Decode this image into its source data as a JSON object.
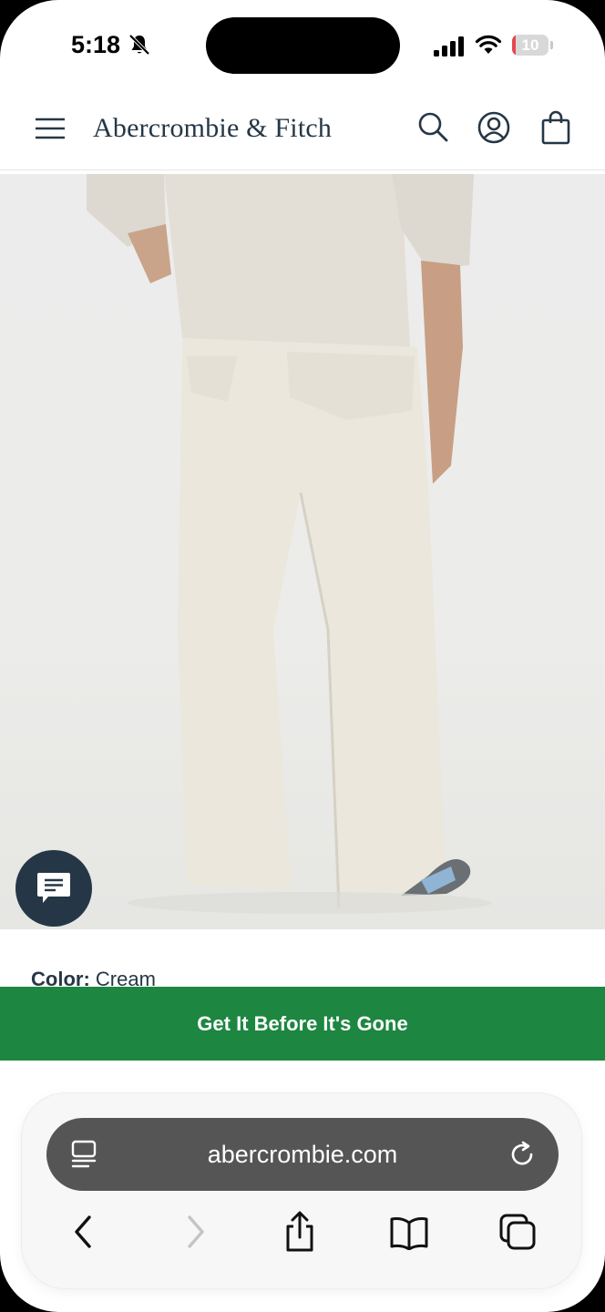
{
  "status_bar": {
    "time": "5:18",
    "battery_level": 10,
    "battery_label": "10"
  },
  "header": {
    "brand": "Abercrombie & Fitch"
  },
  "product": {
    "color_label": "Color:",
    "color_value": "Cream"
  },
  "cta": {
    "label": "Get It Before It's Gone"
  },
  "browser": {
    "url": "abercrombie.com"
  },
  "colors": {
    "brand_navy": "#253746",
    "cta_green": "#1d8641",
    "url_bar": "#555555"
  }
}
